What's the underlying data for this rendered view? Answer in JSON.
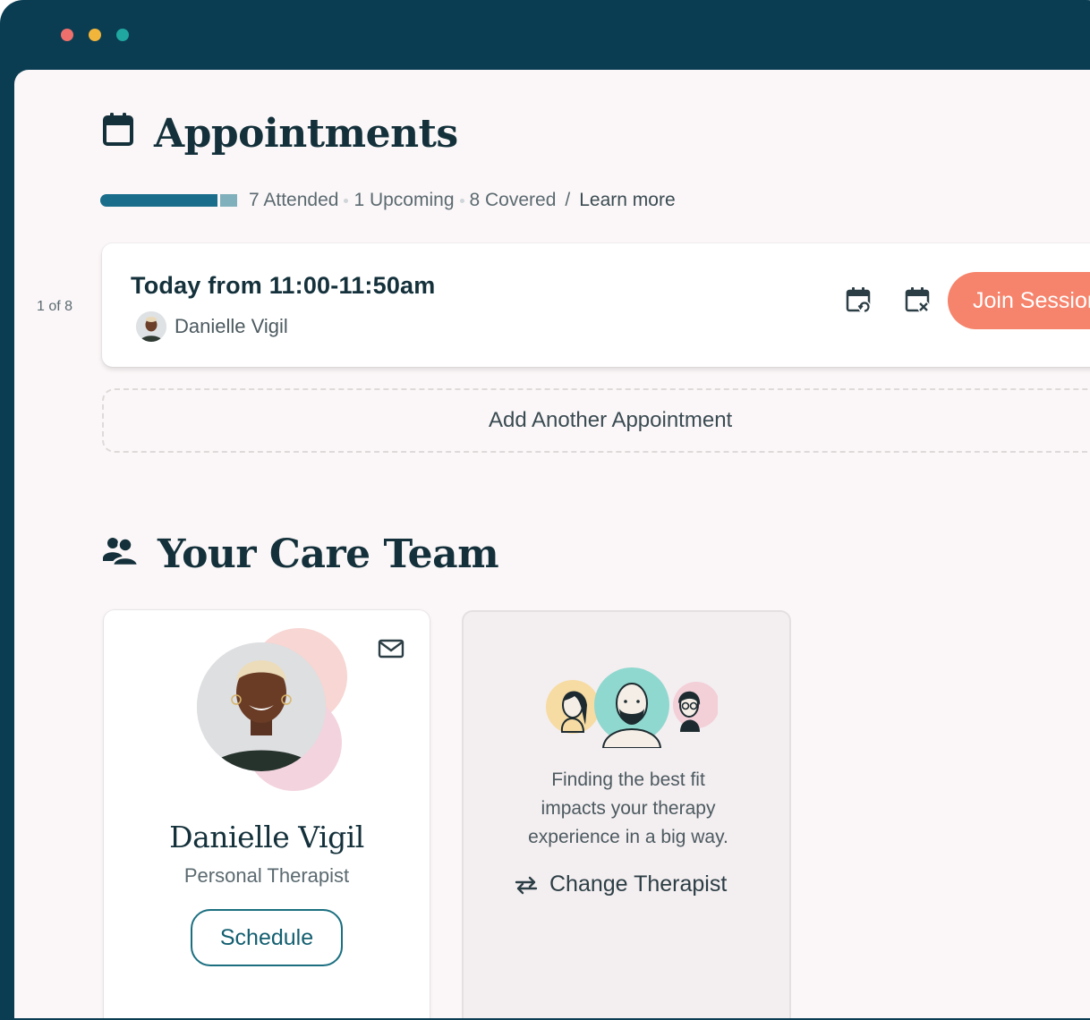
{
  "window": {
    "traffic_lights": [
      "#ef6f6c",
      "#f2b53c",
      "#1fa7a0"
    ]
  },
  "appointments": {
    "title": "Appointments",
    "icon": "calendar-icon",
    "progress": {
      "attended": 7,
      "upcoming": 1,
      "covered": 8,
      "attended_label": "7 Attended",
      "upcoming_label": "1 Upcoming",
      "covered_label": "8 Covered",
      "slash": "/",
      "learn_more": "Learn more",
      "colors": {
        "attended": "#1a6e8c",
        "upcoming": "#7fb0bc",
        "remaining": "#dcdcdc"
      }
    },
    "counter": "1 of 8",
    "card": {
      "time": "Today from 11:00-11:50am",
      "therapist": "Danielle Vigil",
      "reschedule_icon": "calendar-reschedule-icon",
      "cancel_icon": "calendar-cancel-icon",
      "join_label": "Join Session",
      "join_color": "#f6836b"
    },
    "add_label": "Add Another Appointment"
  },
  "care_team": {
    "title": "Your Care Team",
    "icon": "team-icon",
    "therapist": {
      "name": "Danielle Vigil",
      "role": "Personal Therapist",
      "schedule_label": "Schedule",
      "message_icon": "mail-icon"
    },
    "change_card": {
      "lines": [
        "Finding the best fit",
        "impacts your therapy",
        "experience in a big way."
      ],
      "button_label": "Change Therapist",
      "button_icon": "swap-arrows-icon"
    }
  }
}
